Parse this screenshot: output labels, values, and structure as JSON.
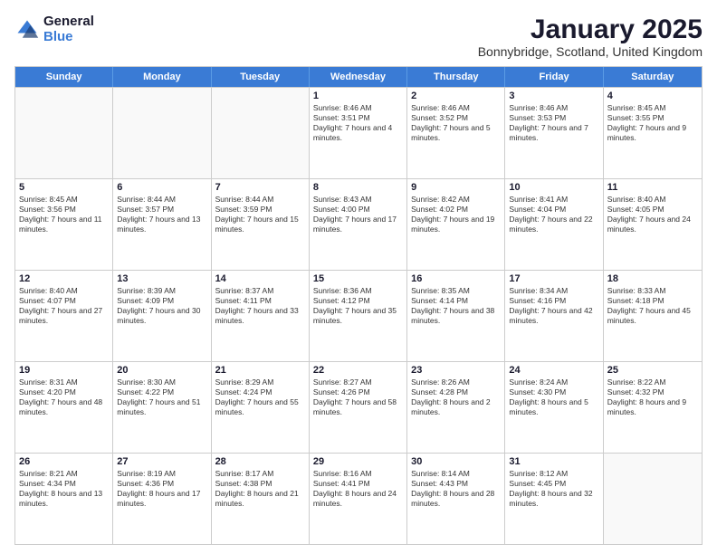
{
  "logo": {
    "general": "General",
    "blue": "Blue"
  },
  "title": "January 2025",
  "subtitle": "Bonnybridge, Scotland, United Kingdom",
  "weekdays": [
    "Sunday",
    "Monday",
    "Tuesday",
    "Wednesday",
    "Thursday",
    "Friday",
    "Saturday"
  ],
  "rows": [
    [
      {
        "day": "",
        "sunrise": "",
        "sunset": "",
        "daylight": ""
      },
      {
        "day": "",
        "sunrise": "",
        "sunset": "",
        "daylight": ""
      },
      {
        "day": "",
        "sunrise": "",
        "sunset": "",
        "daylight": ""
      },
      {
        "day": "1",
        "sunrise": "Sunrise: 8:46 AM",
        "sunset": "Sunset: 3:51 PM",
        "daylight": "Daylight: 7 hours and 4 minutes."
      },
      {
        "day": "2",
        "sunrise": "Sunrise: 8:46 AM",
        "sunset": "Sunset: 3:52 PM",
        "daylight": "Daylight: 7 hours and 5 minutes."
      },
      {
        "day": "3",
        "sunrise": "Sunrise: 8:46 AM",
        "sunset": "Sunset: 3:53 PM",
        "daylight": "Daylight: 7 hours and 7 minutes."
      },
      {
        "day": "4",
        "sunrise": "Sunrise: 8:45 AM",
        "sunset": "Sunset: 3:55 PM",
        "daylight": "Daylight: 7 hours and 9 minutes."
      }
    ],
    [
      {
        "day": "5",
        "sunrise": "Sunrise: 8:45 AM",
        "sunset": "Sunset: 3:56 PM",
        "daylight": "Daylight: 7 hours and 11 minutes."
      },
      {
        "day": "6",
        "sunrise": "Sunrise: 8:44 AM",
        "sunset": "Sunset: 3:57 PM",
        "daylight": "Daylight: 7 hours and 13 minutes."
      },
      {
        "day": "7",
        "sunrise": "Sunrise: 8:44 AM",
        "sunset": "Sunset: 3:59 PM",
        "daylight": "Daylight: 7 hours and 15 minutes."
      },
      {
        "day": "8",
        "sunrise": "Sunrise: 8:43 AM",
        "sunset": "Sunset: 4:00 PM",
        "daylight": "Daylight: 7 hours and 17 minutes."
      },
      {
        "day": "9",
        "sunrise": "Sunrise: 8:42 AM",
        "sunset": "Sunset: 4:02 PM",
        "daylight": "Daylight: 7 hours and 19 minutes."
      },
      {
        "day": "10",
        "sunrise": "Sunrise: 8:41 AM",
        "sunset": "Sunset: 4:04 PM",
        "daylight": "Daylight: 7 hours and 22 minutes."
      },
      {
        "day": "11",
        "sunrise": "Sunrise: 8:40 AM",
        "sunset": "Sunset: 4:05 PM",
        "daylight": "Daylight: 7 hours and 24 minutes."
      }
    ],
    [
      {
        "day": "12",
        "sunrise": "Sunrise: 8:40 AM",
        "sunset": "Sunset: 4:07 PM",
        "daylight": "Daylight: 7 hours and 27 minutes."
      },
      {
        "day": "13",
        "sunrise": "Sunrise: 8:39 AM",
        "sunset": "Sunset: 4:09 PM",
        "daylight": "Daylight: 7 hours and 30 minutes."
      },
      {
        "day": "14",
        "sunrise": "Sunrise: 8:37 AM",
        "sunset": "Sunset: 4:11 PM",
        "daylight": "Daylight: 7 hours and 33 minutes."
      },
      {
        "day": "15",
        "sunrise": "Sunrise: 8:36 AM",
        "sunset": "Sunset: 4:12 PM",
        "daylight": "Daylight: 7 hours and 35 minutes."
      },
      {
        "day": "16",
        "sunrise": "Sunrise: 8:35 AM",
        "sunset": "Sunset: 4:14 PM",
        "daylight": "Daylight: 7 hours and 38 minutes."
      },
      {
        "day": "17",
        "sunrise": "Sunrise: 8:34 AM",
        "sunset": "Sunset: 4:16 PM",
        "daylight": "Daylight: 7 hours and 42 minutes."
      },
      {
        "day": "18",
        "sunrise": "Sunrise: 8:33 AM",
        "sunset": "Sunset: 4:18 PM",
        "daylight": "Daylight: 7 hours and 45 minutes."
      }
    ],
    [
      {
        "day": "19",
        "sunrise": "Sunrise: 8:31 AM",
        "sunset": "Sunset: 4:20 PM",
        "daylight": "Daylight: 7 hours and 48 minutes."
      },
      {
        "day": "20",
        "sunrise": "Sunrise: 8:30 AM",
        "sunset": "Sunset: 4:22 PM",
        "daylight": "Daylight: 7 hours and 51 minutes."
      },
      {
        "day": "21",
        "sunrise": "Sunrise: 8:29 AM",
        "sunset": "Sunset: 4:24 PM",
        "daylight": "Daylight: 7 hours and 55 minutes."
      },
      {
        "day": "22",
        "sunrise": "Sunrise: 8:27 AM",
        "sunset": "Sunset: 4:26 PM",
        "daylight": "Daylight: 7 hours and 58 minutes."
      },
      {
        "day": "23",
        "sunrise": "Sunrise: 8:26 AM",
        "sunset": "Sunset: 4:28 PM",
        "daylight": "Daylight: 8 hours and 2 minutes."
      },
      {
        "day": "24",
        "sunrise": "Sunrise: 8:24 AM",
        "sunset": "Sunset: 4:30 PM",
        "daylight": "Daylight: 8 hours and 5 minutes."
      },
      {
        "day": "25",
        "sunrise": "Sunrise: 8:22 AM",
        "sunset": "Sunset: 4:32 PM",
        "daylight": "Daylight: 8 hours and 9 minutes."
      }
    ],
    [
      {
        "day": "26",
        "sunrise": "Sunrise: 8:21 AM",
        "sunset": "Sunset: 4:34 PM",
        "daylight": "Daylight: 8 hours and 13 minutes."
      },
      {
        "day": "27",
        "sunrise": "Sunrise: 8:19 AM",
        "sunset": "Sunset: 4:36 PM",
        "daylight": "Daylight: 8 hours and 17 minutes."
      },
      {
        "day": "28",
        "sunrise": "Sunrise: 8:17 AM",
        "sunset": "Sunset: 4:38 PM",
        "daylight": "Daylight: 8 hours and 21 minutes."
      },
      {
        "day": "29",
        "sunrise": "Sunrise: 8:16 AM",
        "sunset": "Sunset: 4:41 PM",
        "daylight": "Daylight: 8 hours and 24 minutes."
      },
      {
        "day": "30",
        "sunrise": "Sunrise: 8:14 AM",
        "sunset": "Sunset: 4:43 PM",
        "daylight": "Daylight: 8 hours and 28 minutes."
      },
      {
        "day": "31",
        "sunrise": "Sunrise: 8:12 AM",
        "sunset": "Sunset: 4:45 PM",
        "daylight": "Daylight: 8 hours and 32 minutes."
      },
      {
        "day": "",
        "sunrise": "",
        "sunset": "",
        "daylight": ""
      }
    ]
  ]
}
